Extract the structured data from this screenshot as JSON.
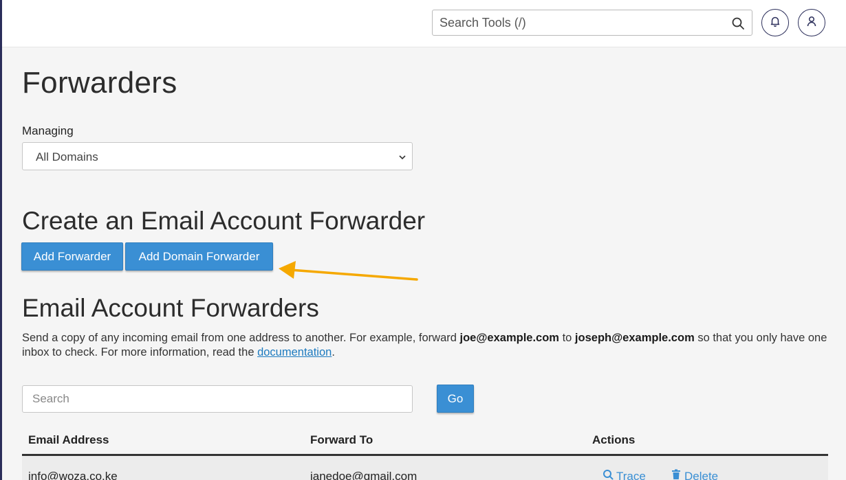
{
  "topbar": {
    "search_placeholder": "Search Tools (/)",
    "icons": [
      "search-icon",
      "bell-icon",
      "user-icon"
    ]
  },
  "page": {
    "title": "Forwarders",
    "managing_label": "Managing",
    "domain_selected": "All Domains"
  },
  "create_section": {
    "heading": "Create an Email Account Forwarder",
    "add_forwarder_label": "Add Forwarder",
    "add_domain_forwarder_label": "Add Domain Forwarder"
  },
  "forwarders_section": {
    "heading": "Email Account Forwarders",
    "desc_part1": "Send a copy of any incoming email from one address to another. For example, forward ",
    "desc_email1": "joe@example.com",
    "desc_part2": " to ",
    "desc_email2": "joseph@example.com",
    "desc_part3": " so that you only have one inbox to check. For more information, read the ",
    "desc_link": "documentation",
    "desc_end": ".",
    "search_placeholder": "Search",
    "go_label": "Go"
  },
  "table": {
    "columns": [
      "Email Address",
      "Forward To",
      "Actions"
    ],
    "rows": [
      {
        "email": "info@woza.co.ke",
        "forward_to": "janedoe@gmail.com",
        "trace_label": "Trace",
        "delete_label": "Delete"
      }
    ]
  },
  "colors": {
    "accent": "#3a8fd4",
    "annotation_arrow": "#f5a800",
    "rail": "#2b2e5a"
  }
}
